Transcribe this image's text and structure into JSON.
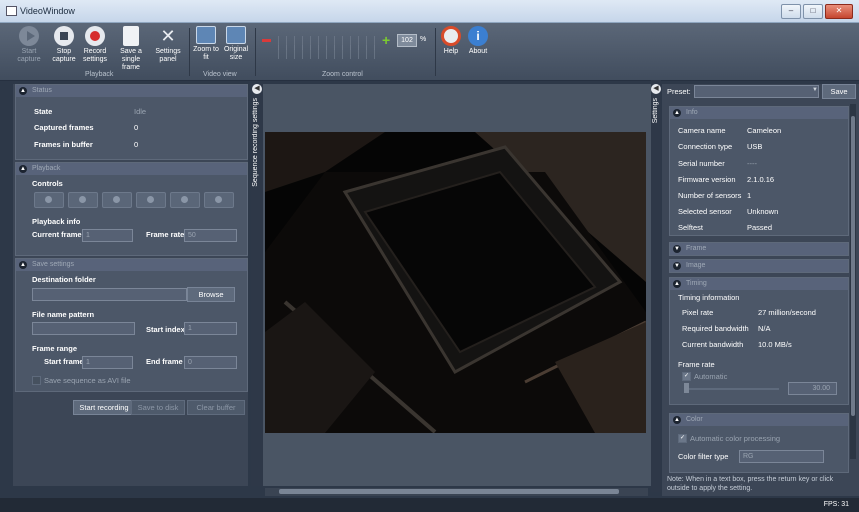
{
  "window": {
    "title": "VideoWindow"
  },
  "ribbon": {
    "start_capture": "Start capture",
    "stop_capture": "Stop capture",
    "record_settings": "Record settings",
    "save_single_frame": "Save a single frame",
    "settings_panel": "Settings panel",
    "zoom_to_fit": "Zoom to fit",
    "original_size": "Original size",
    "help": "Help",
    "about": "About",
    "groups": {
      "playback": "Playback",
      "video_view": "Video view",
      "zoom_control": "Zoom control"
    },
    "zoom": {
      "value": "102",
      "unit": "%"
    }
  },
  "status": {
    "header": "Status",
    "state_label": "State",
    "state_value": "Idle",
    "captured_label": "Captured frames",
    "captured_value": "0",
    "buffer_label": "Frames in buffer",
    "buffer_value": "0"
  },
  "playback": {
    "header": "Playback",
    "controls_label": "Controls",
    "info_label": "Playback info",
    "current_frame_label": "Current frame",
    "current_frame_value": "1",
    "frame_rate_label": "Frame rate",
    "frame_rate_value": "50"
  },
  "save_settings": {
    "header": "Save settings",
    "destination_label": "Destination folder",
    "browse": "Browse",
    "pattern_label": "File name pattern",
    "start_index_label": "Start index",
    "start_index_value": "1",
    "range_label": "Frame range",
    "start_frame_label": "Start frame",
    "start_frame_value": "1",
    "end_frame_label": "End frame",
    "end_frame_value": "0",
    "avi_checkbox": "Save sequence as AVI file"
  },
  "actions": {
    "start_recording": "Start recording",
    "save_to_disk": "Save to disk",
    "clear_buffer": "Clear buffer"
  },
  "sidebars": {
    "sequence": "Sequence recording settings",
    "settings": "Settings"
  },
  "preset": {
    "label": "Preset:",
    "value": "",
    "save": "Save"
  },
  "info": {
    "header": "Info",
    "camera_name_label": "Camera name",
    "camera_name_value": "Cameleon",
    "connection_label": "Connection type",
    "connection_value": "USB",
    "serial_label": "Serial number",
    "serial_value": "----",
    "firmware_label": "Firmware version",
    "firmware_value": "2.1.0.16",
    "sensors_label": "Number of sensors",
    "sensors_value": "1",
    "selected_label": "Selected sensor",
    "selected_value": "Unknown",
    "selftest_label": "Selftest",
    "selftest_value": "Passed"
  },
  "frame": {
    "header": "Frame"
  },
  "image": {
    "header": "Image"
  },
  "timing": {
    "header": "Timing",
    "info_label": "Timing information",
    "pixel_rate_label": "Pixel rate",
    "pixel_rate_value": "27 million/second",
    "req_bw_label": "Required bandwidth",
    "req_bw_value": "N/A",
    "cur_bw_label": "Current bandwidth",
    "cur_bw_value": "10.0 MB/s",
    "frame_rate_label": "Frame rate",
    "automatic": "Automatic",
    "frame_rate_value": "30.00"
  },
  "color": {
    "header": "Color",
    "auto_color": "Automatic color processing",
    "filter_label": "Color filter type",
    "filter_value": "RG"
  },
  "note": "Note: When in a text box, press the return key or click outside to apply the setting.",
  "fps": "FPS: 31"
}
